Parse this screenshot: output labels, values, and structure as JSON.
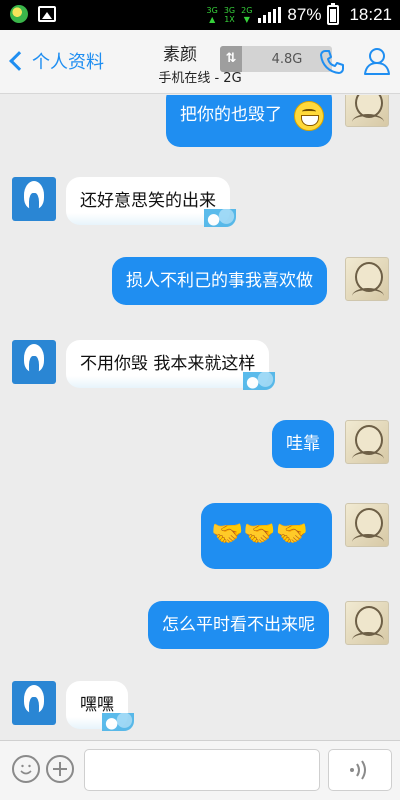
{
  "status_bar": {
    "net_left_top": "3G",
    "net_right_top": "3G",
    "net_right_bottom": "1X",
    "net_far": "2G",
    "battery_percent": "87%",
    "time": "18:21",
    "icons": [
      "app-notification-icon",
      "image-icon",
      "signal-icon",
      "battery-icon"
    ]
  },
  "header": {
    "back_label": "个人资料",
    "contact_name": "素颜",
    "online_status": "手机在线 - 2G",
    "traffic_value": "4.8G",
    "traffic_icon": "data-arrows-icon",
    "call_icon": "phone-icon",
    "profile_icon": "person-icon"
  },
  "messages": [
    {
      "side": "right",
      "text": "把你的也毁了",
      "emoji": "grin-icon"
    },
    {
      "side": "left",
      "text": "还好意思笑的出来"
    },
    {
      "side": "right",
      "text": "损人不利己的事我喜欢做"
    },
    {
      "side": "left",
      "text": "不用你毁 我本来就这样"
    },
    {
      "side": "right",
      "text": "哇靠"
    },
    {
      "side": "right",
      "text": "",
      "emoji": "handshake-icons"
    },
    {
      "side": "right",
      "text": "怎么平时看不出来呢"
    },
    {
      "side": "left",
      "text": "嘿嘿"
    }
  ],
  "input_bar": {
    "emoji_icon": "smiley-icon",
    "plus_icon": "plus-icon",
    "input_value": "",
    "voice_icon": "voice-icon"
  },
  "colors": {
    "accent": "#1f8ef1",
    "chat_bg": "#ececec",
    "status_bar": "#000000",
    "network_green": "#36d13b"
  }
}
